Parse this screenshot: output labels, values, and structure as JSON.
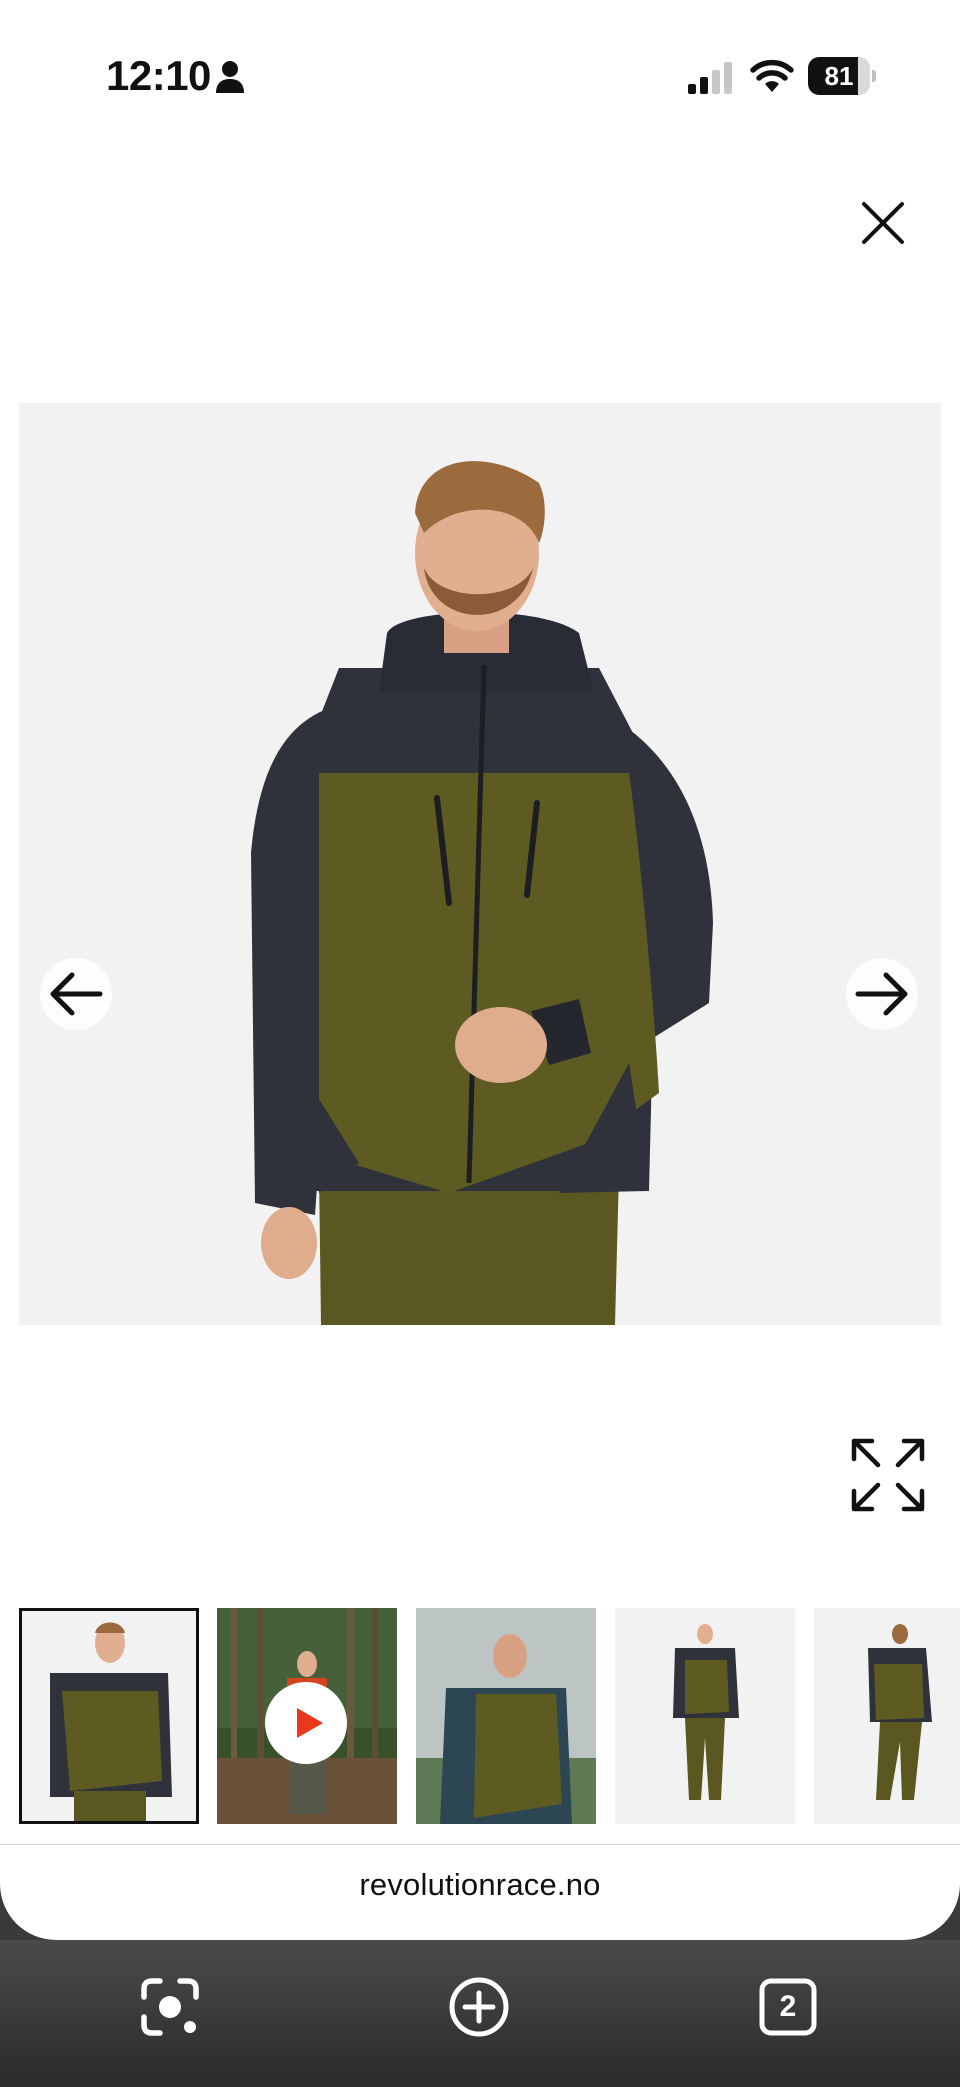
{
  "status_bar": {
    "time": "12:10",
    "battery_level": 81,
    "battery_text": "81",
    "icons": [
      "person-icon",
      "signal-icon",
      "wifi-icon",
      "battery-icon"
    ]
  },
  "gallery": {
    "close_icon": "close-icon",
    "prev_icon": "arrow-left-icon",
    "next_icon": "arrow-right-icon",
    "fullscreen_icon": "expand-icon",
    "colors": {
      "jacket_olive": "#5d5b22",
      "jacket_dark": "#2f313b",
      "background": "#f3f2f3"
    },
    "thumbnails": [
      {
        "kind": "image",
        "selected": true
      },
      {
        "kind": "video",
        "selected": false,
        "icon": "play-icon"
      },
      {
        "kind": "image",
        "selected": false
      },
      {
        "kind": "image",
        "selected": false
      },
      {
        "kind": "image",
        "selected": false
      }
    ]
  },
  "browser": {
    "url": "revolutionrace.no",
    "toolbar": {
      "lens_icon": "lens-icon",
      "add_icon": "add-circle-icon",
      "tabs_count": "2"
    }
  }
}
